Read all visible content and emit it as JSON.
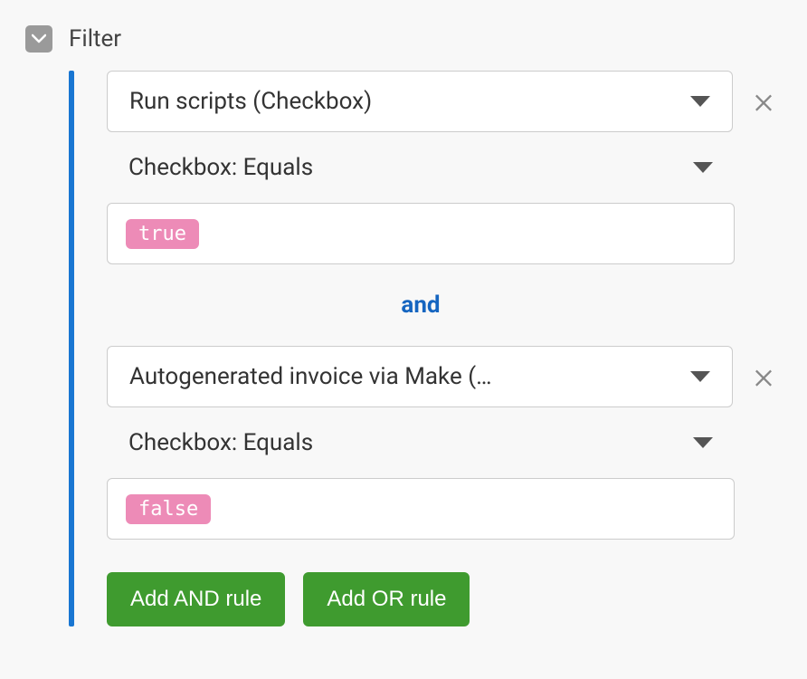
{
  "header": {
    "label": "Filter"
  },
  "rules": [
    {
      "field": "Run scripts (Checkbox)",
      "operator": "Checkbox: Equals",
      "value": "true"
    },
    {
      "field": "Autogenerated invoice via Make (…",
      "operator": "Checkbox: Equals",
      "value": "false"
    }
  ],
  "combinator": "and",
  "buttons": {
    "add_and": "Add AND rule",
    "add_or": "Add OR rule"
  }
}
